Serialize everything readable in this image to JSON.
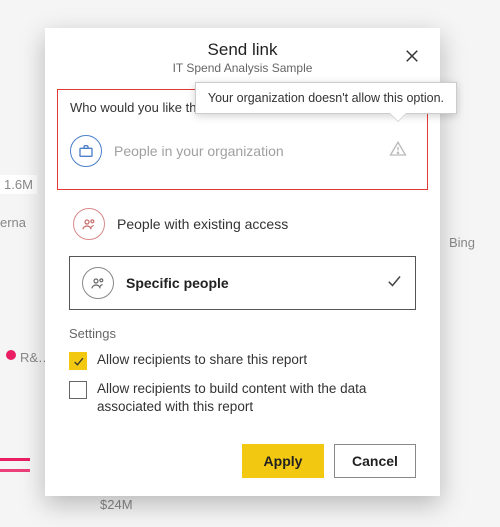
{
  "dialog": {
    "title": "Send link",
    "subtitle": "IT Spend Analysis Sample",
    "prompt": "Who would you like the lin",
    "tooltip": "Your organization doesn't allow this option.",
    "options": {
      "org": "People in your organization",
      "existing": "People with existing access",
      "specific": "Specific people"
    },
    "settings": {
      "heading": "Settings",
      "allowShare": "Allow recipients to share this report",
      "allowBuild": "Allow recipients to build content with the data associated with this report"
    },
    "buttons": {
      "apply": "Apply",
      "cancel": "Cancel"
    }
  },
  "background": {
    "val1": "1.6M",
    "val2": "erna",
    "val3": "R&…",
    "val4": "Bing",
    "val5": "$24M"
  }
}
